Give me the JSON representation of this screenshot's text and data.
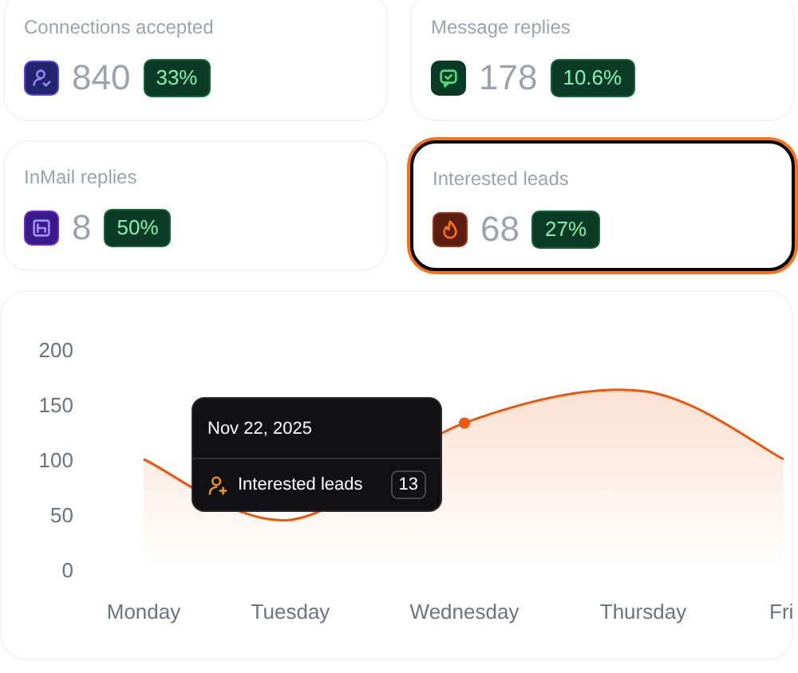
{
  "stats": [
    {
      "title": "Connections accepted",
      "value": "840",
      "change": "33%",
      "kind": "connections",
      "selected": false
    },
    {
      "title": "Message replies",
      "value": "178",
      "change": "10.6%",
      "kind": "messages",
      "selected": false
    },
    {
      "title": "InMail replies",
      "value": "8",
      "change": "50%",
      "kind": "inmail",
      "selected": false
    },
    {
      "title": "Interested leads",
      "value": "68",
      "change": "27%",
      "kind": "leads",
      "selected": true
    }
  ],
  "chart": {
    "chart_data": {
      "type": "area",
      "categories": [
        "Monday",
        "Tuesday",
        "Wednesday",
        "Thursday",
        "Fri"
      ],
      "series": [
        {
          "name": "Interested leads",
          "color": "#ea580c",
          "values": [
            100,
            45,
            133,
            162,
            100
          ]
        }
      ],
      "ylim": [
        0,
        200
      ],
      "yticks": [
        0,
        50,
        100,
        150,
        200
      ],
      "annotations": [
        {
          "x": "Wednesday"
        }
      ]
    },
    "tooltip": {
      "date": "Nov 22, 2025",
      "value": "13"
    }
  }
}
